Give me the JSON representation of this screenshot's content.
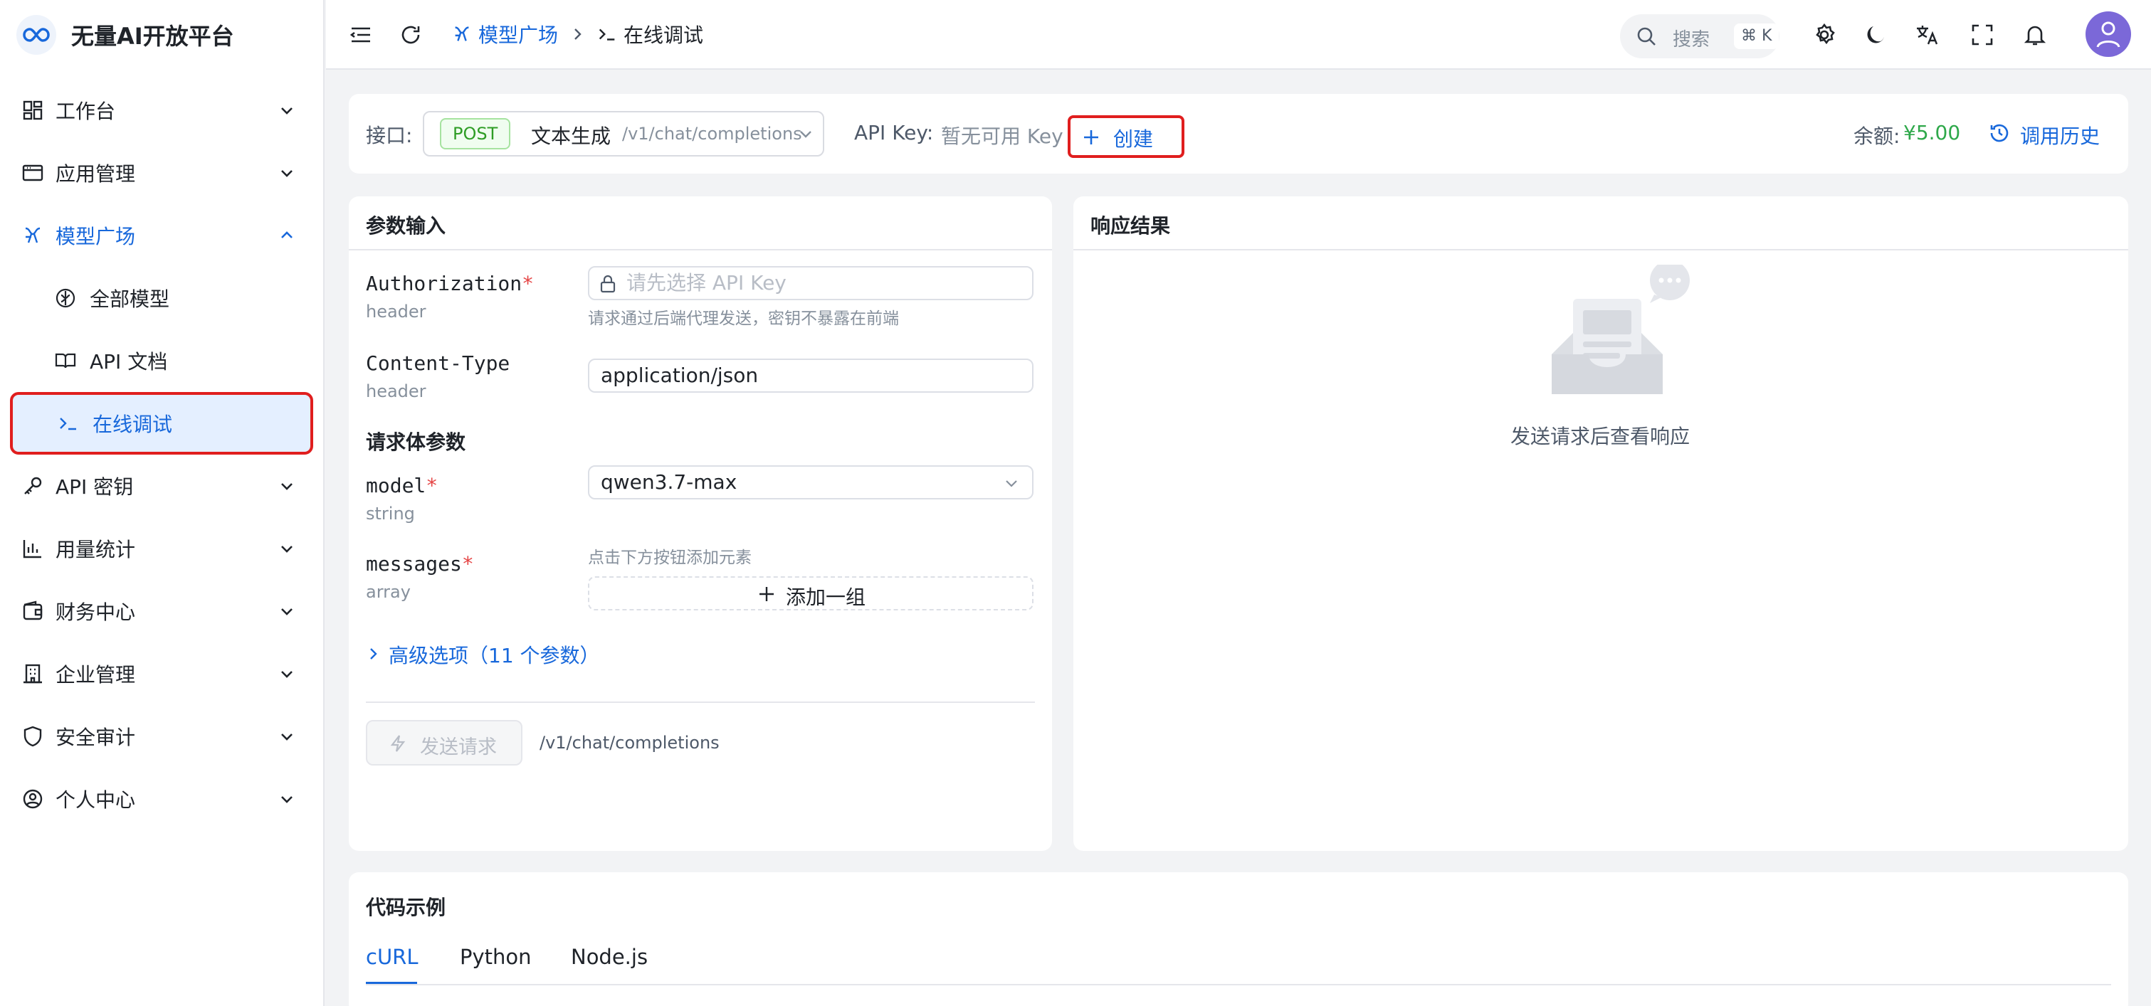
{
  "app": {
    "brand": "无量AI开放平台"
  },
  "sidebar": {
    "items": [
      {
        "label": "工作台",
        "icon": "dashboard-icon"
      },
      {
        "label": "应用管理",
        "icon": "browser-window-icon"
      },
      {
        "label": "模型广场",
        "icon": "model-icon",
        "expanded": true
      },
      {
        "label": "API 密钥",
        "icon": "key-icon"
      },
      {
        "label": "用量统计",
        "icon": "bar-chart-icon"
      },
      {
        "label": "财务中心",
        "icon": "wallet-icon"
      },
      {
        "label": "企业管理",
        "icon": "building-icon"
      },
      {
        "label": "安全审计",
        "icon": "shield-icon"
      },
      {
        "label": "个人中心",
        "icon": "user-circle-icon"
      }
    ],
    "subitems": [
      {
        "label": "全部模型",
        "icon": "brain-icon"
      },
      {
        "label": "API 文档",
        "icon": "book-icon"
      },
      {
        "label": "在线调试",
        "icon": "terminal-icon",
        "selected": true
      }
    ]
  },
  "topbar": {
    "breadcrumb": [
      "模型广场",
      "在线调试"
    ],
    "search_label": "搜索",
    "search_shortcut": "⌘ K"
  },
  "endpoint": {
    "label": "接口:",
    "method": "POST",
    "name": "文本生成",
    "path": "/v1/chat/completions",
    "apikey_label": "API Key:",
    "apikey_value": "暂无可用 Key",
    "create_label": "创建",
    "balance_label": "余额:",
    "balance_value": "¥5.00",
    "history_label": "调用历史"
  },
  "params": {
    "title": "参数输入",
    "authorization": {
      "name": "Authorization",
      "location": "header",
      "placeholder": "请先选择 API Key",
      "hint": "请求通过后端代理发送，密钥不暴露在前端"
    },
    "content_type": {
      "name": "Content-Type",
      "location": "header",
      "value": "application/json"
    },
    "body_title": "请求体参数",
    "model": {
      "name": "model",
      "type": "string",
      "value": "qwen3.7-max"
    },
    "messages": {
      "name": "messages",
      "type": "array",
      "hint": "点击下方按钮添加元素",
      "add_label": "添加一组"
    },
    "advanced_label": "高级选项（11 个参数）",
    "send_label": "发送请求",
    "send_path": "/v1/chat/completions"
  },
  "response": {
    "title": "响应结果",
    "empty_text": "发送请求后查看响应"
  },
  "code": {
    "title": "代码示例",
    "tabs": [
      "cURL",
      "Python",
      "Node.js"
    ],
    "active_tab": "cURL"
  },
  "colors": {
    "accent": "#1868db",
    "highlight": "#e01e1e",
    "balance": "#2ea84a",
    "avatar": "#7b68d8"
  }
}
